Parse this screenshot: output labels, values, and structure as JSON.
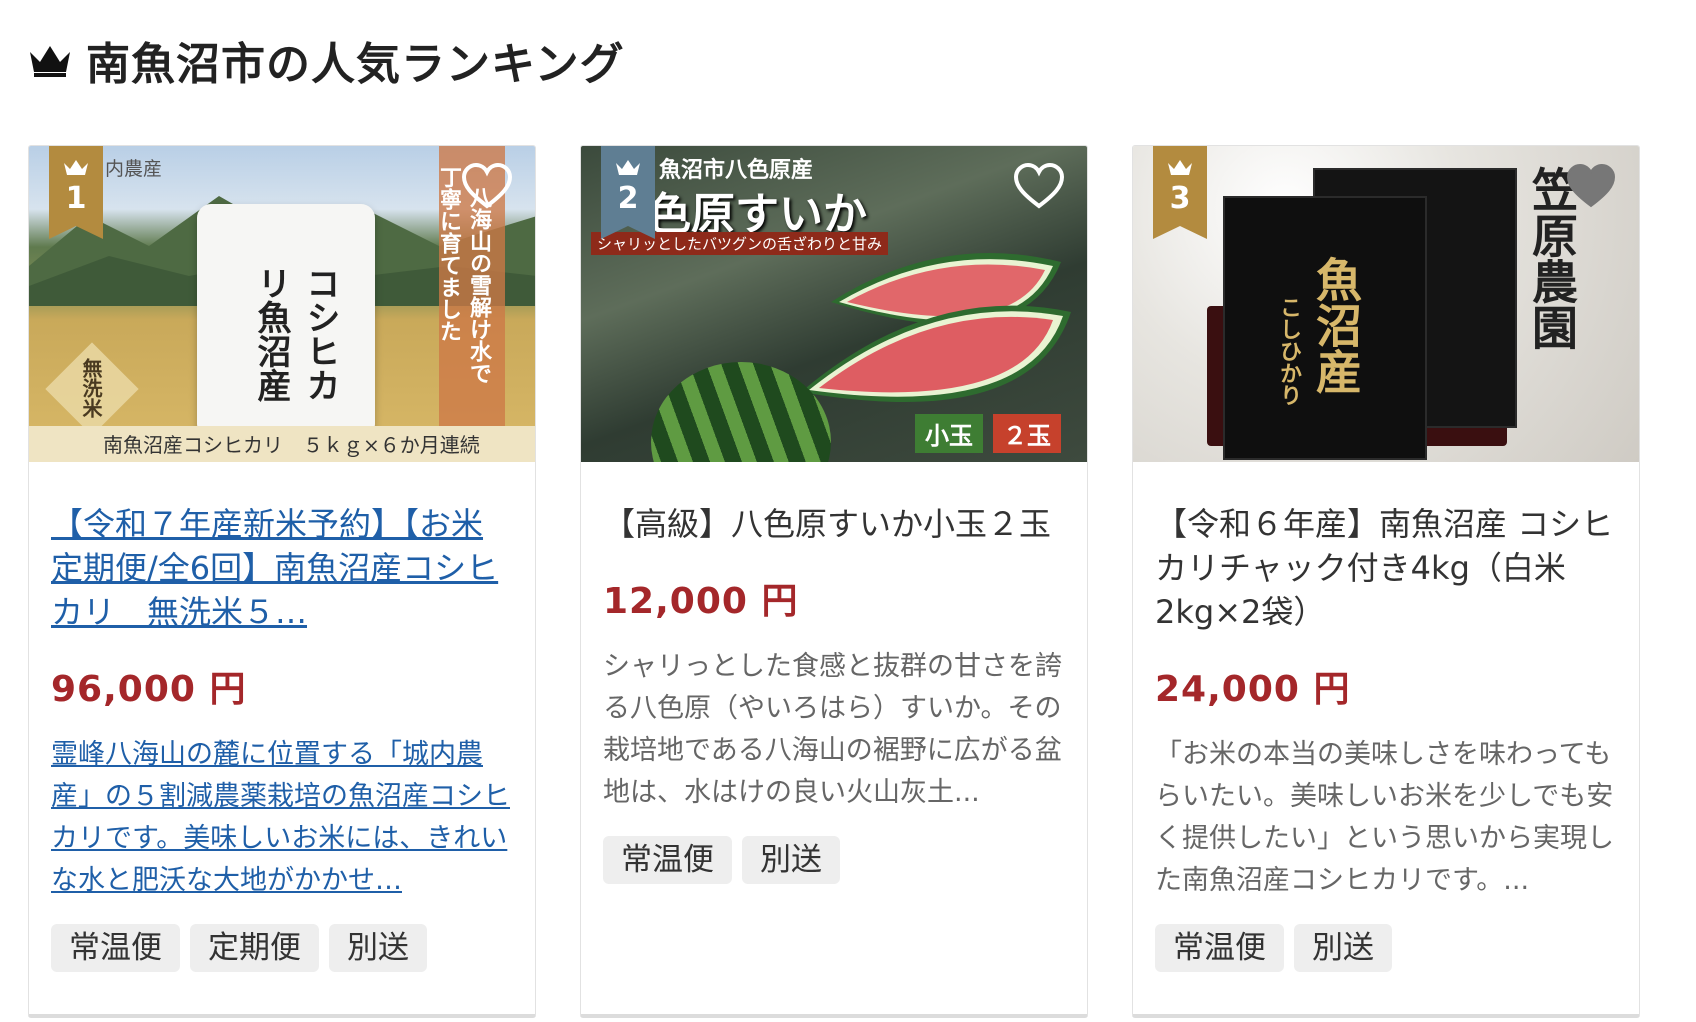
{
  "header": {
    "title": "南魚沼市の人気ランキング",
    "icon": "crown-icon"
  },
  "colors": {
    "accent_price": "#a4272a",
    "link": "#1f5fa8",
    "badge_gold": "#b38b3f",
    "badge_blue": "#5f7e93"
  },
  "products": [
    {
      "rank": "1",
      "image_text": {
        "vertical": "丁寧に育てました",
        "vertical2": "八海山の雪解け水で",
        "caption": "南魚沼産コシヒカリ　５ｋｇ×６か月連続",
        "bag": "コシヒカリ魚沼産",
        "diamond": "無洗米",
        "corner": "内農産"
      },
      "title": "【令和７年産新米予約】【お米定期便/全6回】南魚沼産コシヒカリ　無洗米５…",
      "price": "96,000 円",
      "description": "霊峰八海山の麓に位置する「城内農産」の５割減農薬栽培の魚沼産コシヒカリです。美味しいお米には、きれいな水と肥沃な大地がかかせ…",
      "tags": [
        "常温便",
        "定期便",
        "別送"
      ]
    },
    {
      "rank": "2",
      "image_text": {
        "top": "魚沼市八色原産",
        "main": "色原すいか",
        "sub": "シャリッとしたバツグンの舌ざわりと甘み",
        "chip1": "小玉",
        "chip2": "２玉"
      },
      "title": "【高級】八色原すいか小玉２玉",
      "price": "12,000 円",
      "description": "シャリっとした食感と抜群の甘さを誇る八色原（やいろはら）すいか。その栽培地である八海山の裾野に広がる盆地は、水はけの良い火山灰土...",
      "tags": [
        "常温便",
        "別送"
      ]
    },
    {
      "rank": "3",
      "image_text": {
        "vertical": "笠原農園",
        "bag": "魚沼産",
        "bag_small": "こしひかり"
      },
      "title": "【令和６年産】南魚沼産 コシヒカリチャック付き4kg（白米2kg×2袋）",
      "price": "24,000 円",
      "description": "「お米の本当の美味しさを味わってもらいたい。美味しいお米を少しでも安く提供したい」という思いから実現した南魚沼産コシヒカリです。...",
      "tags": [
        "常温便",
        "別送"
      ]
    }
  ]
}
